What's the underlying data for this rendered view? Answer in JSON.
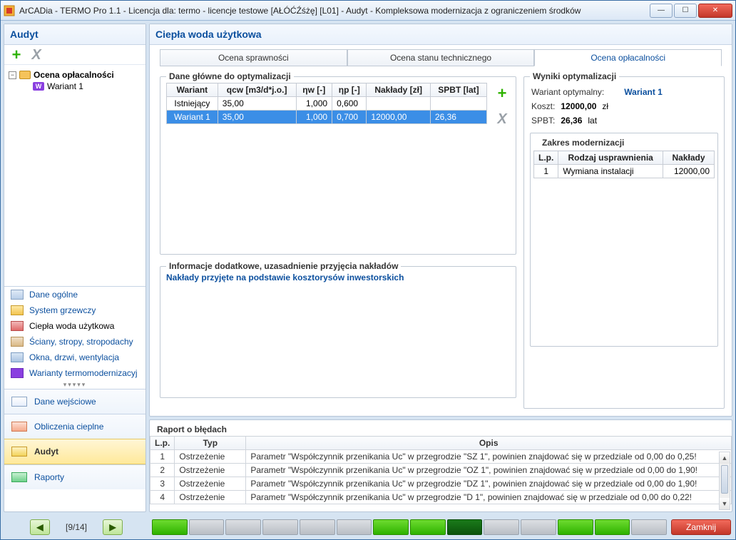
{
  "window": {
    "title": "ArCADia - TERMO Pro 1.1 - Licencja dla: termo - licencje testowe [AŁÓĆŹśżę] [L01] - Audyt - Kompleksowa modernizacja z ograniczeniem środków"
  },
  "left": {
    "title": "Audyt",
    "tree": {
      "root": "Ocena opłacalności",
      "child": "Wariant 1"
    },
    "nav": [
      {
        "label": "Dane ogólne"
      },
      {
        "label": "System grzewczy"
      },
      {
        "label": "Ciepła woda użytkowa"
      },
      {
        "label": "Ściany, stropy, stropodachy"
      },
      {
        "label": "Okna, drzwi, wentylacja"
      },
      {
        "label": "Warianty termomodernizacyj"
      }
    ],
    "sections": [
      {
        "label": "Dane wejściowe"
      },
      {
        "label": "Obliczenia cieplne"
      },
      {
        "label": "Audyt"
      },
      {
        "label": "Raporty"
      }
    ]
  },
  "main": {
    "title": "Ciepła woda użytkowa",
    "tabs": [
      "Ocena sprawności",
      "Ocena stanu technicznego",
      "Ocena opłacalności"
    ],
    "opt_group": "Dane główne do optymalizacji",
    "grid": {
      "headers": [
        "Wariant",
        "qcw [m3/d*j.o.]",
        "ηw [-]",
        "ηp [-]",
        "Nakłady [zł]",
        "SPBT [lat]"
      ],
      "rows": [
        {
          "c0": "Istniejący",
          "c1": "35,00",
          "c2": "1,000",
          "c3": "0,600",
          "c4": "",
          "c5": ""
        },
        {
          "c0": "Wariant 1",
          "c1": "35,00",
          "c2": "1,000",
          "c3": "0,700",
          "c4": "12000,00",
          "c5": "26,36"
        }
      ]
    },
    "info_group": "Informacje dodatkowe, uzasadnienie przyjęcia nakładów",
    "info_link": "Nakłady przyjęte na podstawie kosztorysów inwestorskich",
    "results": {
      "title": "Wyniki optymalizacji",
      "optimal_lbl": "Wariant optymalny:",
      "optimal_val": "Wariant 1",
      "cost_lbl": "Koszt:",
      "cost_val": "12000,00",
      "cost_unit": "zł",
      "spbt_lbl": "SPBT:",
      "spbt_val": "26,36",
      "spbt_unit": "lat",
      "scope_title": "Zakres modernizacji",
      "scope_headers": [
        "L.p.",
        "Rodzaj usprawnienia",
        "Nakłady"
      ],
      "scope_rows": [
        {
          "lp": "1",
          "name": "Wymiana instalacji",
          "cost": "12000,00"
        }
      ]
    }
  },
  "errors": {
    "title": "Raport o błędach",
    "headers": [
      "L.p.",
      "Typ",
      "Opis"
    ],
    "rows": [
      {
        "lp": "1",
        "typ": "Ostrzeżenie",
        "opis": "Parametr \"Współczynnik przenikania Uc\" w przegrodzie \"SZ 1\", powinien znajdować się w przedziale od 0,00 do 0,25!"
      },
      {
        "lp": "2",
        "typ": "Ostrzeżenie",
        "opis": "Parametr \"Współczynnik przenikania Uc\" w przegrodzie \"OZ 1\", powinien znajdować się w przedziale od 0,00 do 1,90!"
      },
      {
        "lp": "3",
        "typ": "Ostrzeżenie",
        "opis": "Parametr \"Współczynnik przenikania Uc\" w przegrodzie \"DZ 1\", powinien znajdować się w przedziale od 0,00 do 1,90!"
      },
      {
        "lp": "4",
        "typ": "Ostrzeżenie",
        "opis": "Parametr \"Współczynnik przenikania Uc\" w przegrodzie \"D 1\", powinien znajdować się w przedziale od 0,00 do 0,22!"
      }
    ]
  },
  "bottom": {
    "page": "[9/14]",
    "close": "Zamknij"
  }
}
